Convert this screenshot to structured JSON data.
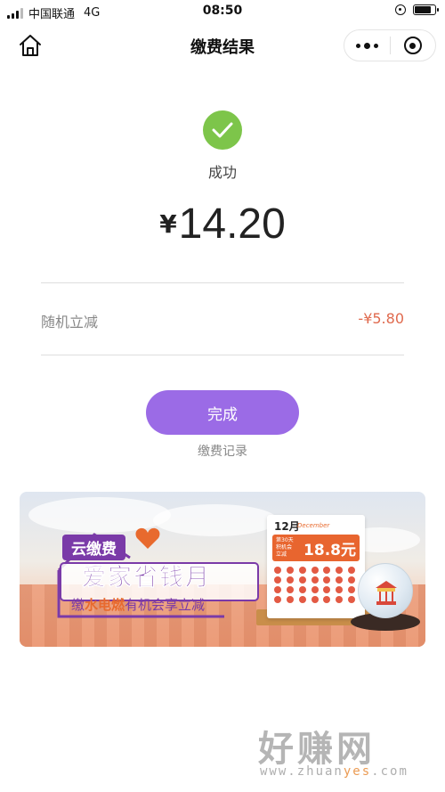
{
  "status_bar": {
    "carrier": "中国联通",
    "network": "4G",
    "time": "08:50",
    "battery_level": 0.8
  },
  "nav": {
    "title": "缴费结果",
    "home_icon": "home-icon",
    "more_icon": "more-dots-icon",
    "close_icon": "close-miniprogram-icon"
  },
  "result": {
    "icon": "check-circle-icon",
    "icon_color": "#7dc54a",
    "status": "成功",
    "currency": "¥",
    "amount": "14.20"
  },
  "discount": {
    "label": "随机立减",
    "value": "-¥5.80",
    "value_color": "#e06a4e"
  },
  "actions": {
    "done_label": "完成",
    "done_color": "#9b6be6",
    "records_label": "缴费记录"
  },
  "banner": {
    "tag": "云缴费",
    "title": "爱家省钱月",
    "subtitle_pre": "缴",
    "subtitle_highlight": "水电燃",
    "subtitle_post": "有机会享立减",
    "calendar_month": "12月",
    "calendar_month_en": "December",
    "promo_small_1": "第30天",
    "promo_small_2": "积机会",
    "promo_small_3": "立减",
    "promo_big": "18.8元"
  },
  "watermark": {
    "main": "好赚网",
    "url_pre": "www.zhuan",
    "url_highlight": "yes",
    "url_post": ".com"
  }
}
